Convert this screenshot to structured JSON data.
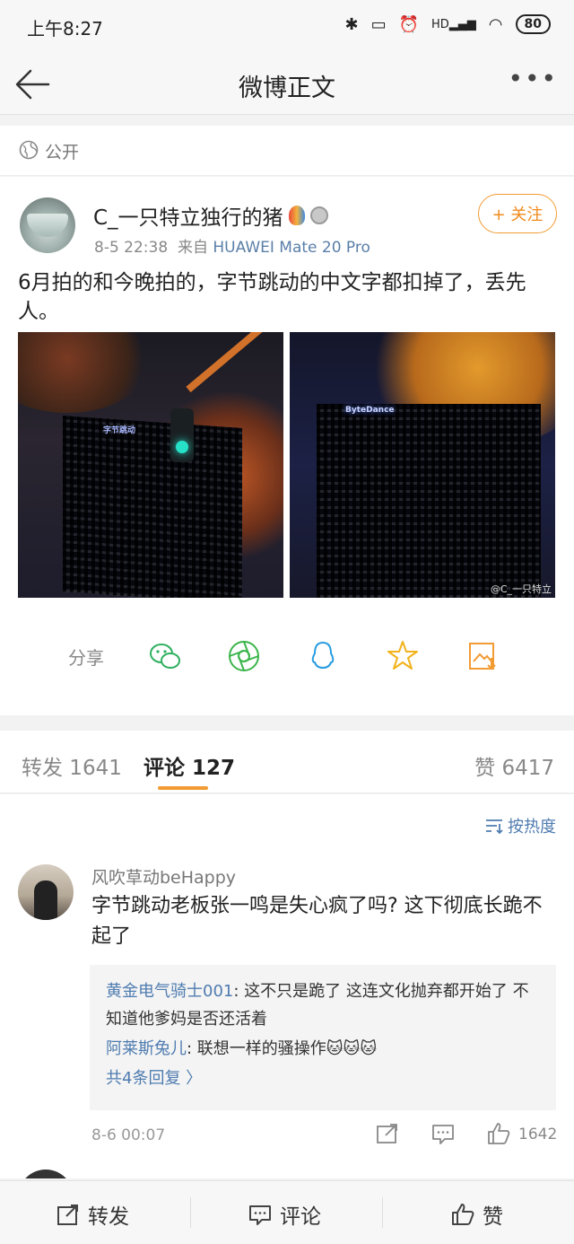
{
  "status_bar": {
    "time": "上午8:27",
    "battery": "80",
    "network_label": "HD"
  },
  "nav": {
    "title": "微博正文"
  },
  "visibility": {
    "label": "公开"
  },
  "post": {
    "username": "C_一只特立独行的猪",
    "date": "8-5 22:38",
    "source_prefix": "来自",
    "source": "HUAWEI Mate 20 Pro",
    "follow_label": "+ 关注",
    "text": "6月拍的和今晚拍的，字节跳动的中文字都扣掉了，丢先人。",
    "images": [
      {
        "sign_text": "字节跳动"
      },
      {
        "sign_text": "ByteDance",
        "watermark": "@C_一只特立"
      }
    ]
  },
  "share": {
    "label": "分享",
    "targets": [
      "wechat-icon",
      "moments-icon",
      "qq-icon",
      "qzone-icon",
      "save-image-icon"
    ]
  },
  "tabs": {
    "repost": "转发 1641",
    "comment": "评论 127",
    "like": "赞 6417"
  },
  "comments": {
    "sort_label": "按热度",
    "items": [
      {
        "user": "风吹草动beHappy",
        "text": "字节跳动老板张一鸣是失心疯了吗? 这下彻底长跪不起了",
        "replies": [
          {
            "user": "黄金电气骑士001",
            "text": ": 这不只是跪了 这连文化抛弃都开始了 不知道他爹妈是否还活着"
          },
          {
            "user": "阿莱斯兔儿",
            "text": ": 联想一样的骚操作🐱🐱🐱"
          }
        ],
        "more_replies": "共4条回复 〉",
        "time": "8-6 00:07",
        "like_count": "1642"
      }
    ]
  },
  "bottom_bar": {
    "repost": "转发",
    "comment": "评论",
    "like": "赞"
  },
  "colors": {
    "accent": "#f29b33",
    "link": "#4f7cb0"
  }
}
